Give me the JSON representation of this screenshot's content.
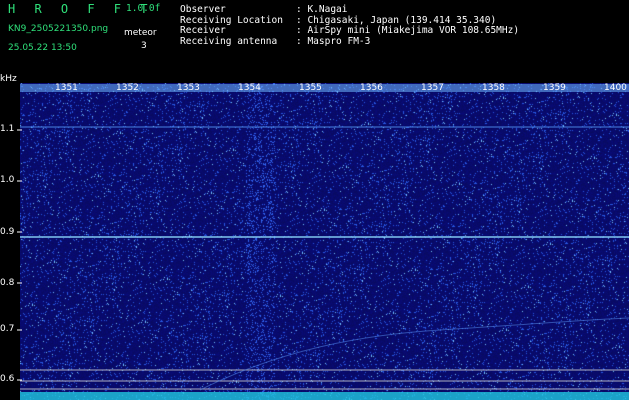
{
  "header": {
    "title": "H R O F F T",
    "version": "1.0.0f",
    "filename": "KN9_2505221350.png",
    "timestamp": "25.05.22 13:50",
    "meteor_label": "meteor",
    "meteor_count": "3"
  },
  "info": [
    {
      "label": "Observer",
      "value": ": K.Nagai"
    },
    {
      "label": "Receiving Location",
      "value": ": Chigasaki, Japan (139.414 35.340)"
    },
    {
      "label": "Receiver",
      "value": ": AirSpy mini (Miakejima VOR 108.65MHz)"
    },
    {
      "label": "Receiving antenna",
      "value": ": Maspro FM-3"
    }
  ],
  "spectrogram": {
    "y_unit": "kHz",
    "y_ticks": [
      "1.1",
      "1.0",
      "0.9",
      "0.8",
      "0.7",
      "0.6"
    ],
    "time_ticks": [
      "1351",
      "1352",
      "1353",
      "1354",
      "1355",
      "1356",
      "1357",
      "1358",
      "1359",
      "1400"
    ],
    "colors": {
      "background": "#0a0a6e",
      "noise": "#3a5cff",
      "signal": "#7fd6ff",
      "grid": "#c8c8c8"
    }
  }
}
